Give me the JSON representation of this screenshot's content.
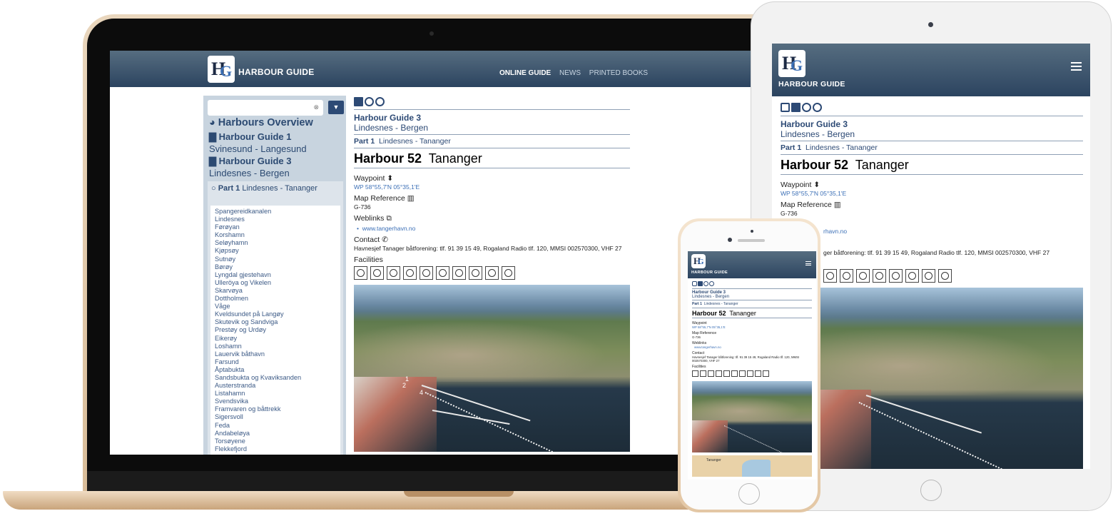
{
  "site": {
    "brand": "HARBOUR GUIDE",
    "logo_text": "HG",
    "nav": [
      "ONLINE GUIDE",
      "NEWS",
      "PRINTED BOOKS"
    ]
  },
  "sidebar": {
    "overview": "Harbours Overview",
    "guide1_title": "Harbour Guide 1",
    "guide1_sub": "Svinesund - Langesund",
    "guide3_title": "Harbour Guide 3",
    "guide3_sub": "Lindesnes - Bergen",
    "part_label": "Part 1",
    "part_sub": "Lindesnes - Tananger",
    "harbours": [
      "Spangereidkanalen",
      "Lindesnes",
      "Førøyan",
      "Korshamn",
      "Seløyhamn",
      "Kjøpsøy",
      "Sutnøy",
      "Børøy",
      "Lyngdal gjestehavn",
      "Ulleröya og Vikelen",
      "Skarvøya",
      "Dottholmen",
      "Våge",
      "Kveldsundet på Langøy",
      "Skutevik og Sandviga",
      "Prestøy og Urdøy",
      "Eikerøy",
      "Loshamn",
      "Lauervik båthavn",
      "Farsund",
      "Åptabukta",
      "Sandsbukta og Kvaviksanden",
      "Austerstranda",
      "Listahamn",
      "Svendsvika",
      "Framvaren og båttrekk",
      "Sigersvoll",
      "Feda",
      "Andabeløya",
      "Torsøyene",
      "Flekkefjord"
    ]
  },
  "content": {
    "guide_title": "Harbour Guide 3",
    "guide_sub": "Lindesnes - Bergen",
    "part_label": "Part 1",
    "part_sub": "Lindesnes - Tananger",
    "harbour_no": "Harbour 52",
    "harbour_name": "Tananger",
    "waypoint_label": "Waypoint",
    "waypoint_value": "WP 58°55,7'N 05°35,1'E",
    "mapref_label": "Map Reference",
    "mapref_value": "G-736",
    "weblinks_label": "Weblinks",
    "weblink": "www.tangerhavn.no",
    "contact_label": "Contact",
    "contact_value": "Havnesjef Tanager båtforening: tlf. 91 39 15 49, Rogaland Radio tlf. 120, MMSI 002570300, VHF 27",
    "facilities_label": "Facilities",
    "facility_icons": [
      "wc-icon",
      "fuel-icon",
      "water-tap-icon",
      "power-icon",
      "ice-icon",
      "shopping-cart-icon",
      "shower-icon",
      "trash-icon",
      "pump-out-icon",
      "slipway-icon"
    ],
    "photo_labels": [
      "1",
      "2",
      "4"
    ]
  },
  "tablet": {
    "contact_fragment": "ger båtforening: tlf. 91 39 15 49, Rogaland Radio tlf. 120, MMSI 002570300, VHF 27",
    "weblink_fragment": "rhavn.no"
  },
  "phone": {
    "contact_value": "Havnesjef Tanager båtforening: tlf. 91 39 15 49, Rogaland Radio tlf. 120, MMSI 002570300, VHF 27",
    "map_label": "Tananger"
  },
  "colors": {
    "nav_top": "#566d80",
    "nav_bottom": "#2c4460",
    "accent": "#2d4a75",
    "link": "#3b6fb6"
  }
}
